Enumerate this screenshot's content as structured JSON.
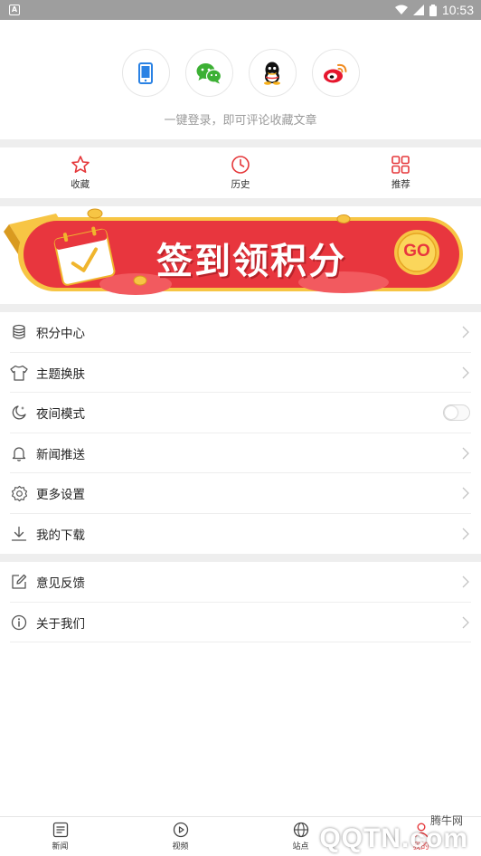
{
  "status_bar": {
    "time": "10:53"
  },
  "login": {
    "hint": "一键登录，即可评论收藏文章",
    "methods": [
      {
        "name": "phone-login",
        "icon": "phone-icon"
      },
      {
        "name": "wechat-login",
        "icon": "wechat-icon"
      },
      {
        "name": "qq-login",
        "icon": "qq-icon"
      },
      {
        "name": "weibo-login",
        "icon": "weibo-icon"
      }
    ]
  },
  "quick_actions": [
    {
      "label": "收藏",
      "icon": "star-icon"
    },
    {
      "label": "历史",
      "icon": "clock-icon"
    },
    {
      "label": "推荐",
      "icon": "grid-icon"
    }
  ],
  "banner": {
    "title": "签到领积分",
    "button": "GO"
  },
  "menu_group1": [
    {
      "label": "积分中心",
      "icon": "coins-icon"
    },
    {
      "label": "主题换肤",
      "icon": "shirt-icon"
    },
    {
      "label": "夜间模式",
      "icon": "moon-icon",
      "toggle": false
    },
    {
      "label": "新闻推送",
      "icon": "bell-icon"
    },
    {
      "label": "更多设置",
      "icon": "gear-icon"
    },
    {
      "label": "我的下载",
      "icon": "download-icon"
    }
  ],
  "menu_group2": [
    {
      "label": "意见反馈",
      "icon": "edit-icon"
    },
    {
      "label": "关于我们",
      "icon": "info-icon"
    }
  ],
  "bottom_nav": [
    {
      "label": "新闻",
      "icon": "news-icon"
    },
    {
      "label": "视频",
      "icon": "video-icon"
    },
    {
      "label": "站点",
      "icon": "site-icon"
    },
    {
      "label": "我的",
      "icon": "user-icon"
    }
  ],
  "watermark": {
    "text": "腾牛网",
    "brand": "QQTN.com"
  },
  "colors": {
    "accent": "#e5383b",
    "banner_red": "#e8363e",
    "banner_gold": "#f7c544",
    "wechat": "#3cb034",
    "phone": "#2a82e4"
  }
}
